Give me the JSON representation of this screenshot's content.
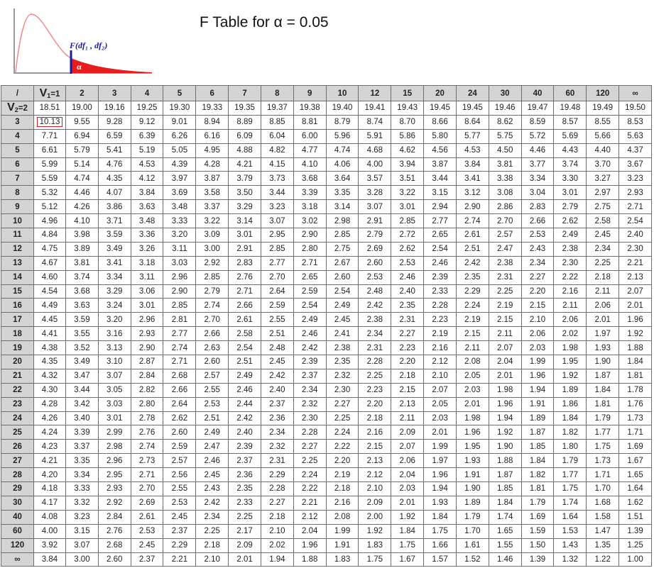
{
  "title": "F Table for α = 0.05",
  "figure": {
    "func_label": "F(df₁ , df₂)",
    "alpha_label": "α",
    "fill_color": "#e81c1c",
    "marker_color": "#1a1aa0"
  },
  "corner": "/",
  "v1_label": {
    "main": "V",
    "sub": "1",
    "suffix": "=1"
  },
  "v2_label": {
    "main": "V",
    "sub": "2",
    "suffix": "=2"
  },
  "col_headers": [
    "2",
    "3",
    "4",
    "5",
    "6",
    "7",
    "8",
    "9",
    "10",
    "12",
    "15",
    "20",
    "24",
    "30",
    "40",
    "60",
    "120",
    "∞"
  ],
  "rows": [
    {
      "df": "2",
      "values": [
        "18.51",
        "19.00",
        "19.16",
        "19.25",
        "19.30",
        "19.33",
        "19.35",
        "19.37",
        "19.38",
        "19.40",
        "19.41",
        "19.43",
        "19.45",
        "19.45",
        "19.46",
        "19.47",
        "19.48",
        "19.49",
        "19.50"
      ]
    },
    {
      "df": "3",
      "values": [
        "10.13",
        "9.55",
        "9.28",
        "9.12",
        "9.01",
        "8.94",
        "8.89",
        "8.85",
        "8.81",
        "8.79",
        "8.74",
        "8.70",
        "8.66",
        "8.64",
        "8.62",
        "8.59",
        "8.57",
        "8.55",
        "8.53"
      ]
    },
    {
      "df": "4",
      "values": [
        "7.71",
        "6.94",
        "6.59",
        "6.39",
        "6.26",
        "6.16",
        "6.09",
        "6.04",
        "6.00",
        "5.96",
        "5.91",
        "5.86",
        "5.80",
        "5.77",
        "5.75",
        "5.72",
        "5.69",
        "5.66",
        "5.63"
      ]
    },
    {
      "df": "5",
      "values": [
        "6.61",
        "5.79",
        "5.41",
        "5.19",
        "5.05",
        "4.95",
        "4.88",
        "4.82",
        "4.77",
        "4.74",
        "4.68",
        "4.62",
        "4.56",
        "4.53",
        "4.50",
        "4.46",
        "4.43",
        "4.40",
        "4.37"
      ]
    },
    {
      "df": "6",
      "values": [
        "5.99",
        "5.14",
        "4.76",
        "4.53",
        "4.39",
        "4.28",
        "4.21",
        "4.15",
        "4.10",
        "4.06",
        "4.00",
        "3.94",
        "3.87",
        "3.84",
        "3.81",
        "3.77",
        "3.74",
        "3.70",
        "3.67"
      ]
    },
    {
      "df": "7",
      "values": [
        "5.59",
        "4.74",
        "4.35",
        "4.12",
        "3.97",
        "3.87",
        "3.79",
        "3.73",
        "3.68",
        "3.64",
        "3.57",
        "3.51",
        "3.44",
        "3.41",
        "3.38",
        "3.34",
        "3.30",
        "3.27",
        "3.23"
      ]
    },
    {
      "df": "8",
      "values": [
        "5.32",
        "4.46",
        "4.07",
        "3.84",
        "3.69",
        "3.58",
        "3.50",
        "3.44",
        "3.39",
        "3.35",
        "3.28",
        "3.22",
        "3.15",
        "3.12",
        "3.08",
        "3.04",
        "3.01",
        "2.97",
        "2.93"
      ]
    },
    {
      "df": "9",
      "values": [
        "5.12",
        "4.26",
        "3.86",
        "3.63",
        "3.48",
        "3.37",
        "3.29",
        "3.23",
        "3.18",
        "3.14",
        "3.07",
        "3.01",
        "2.94",
        "2.90",
        "2.86",
        "2.83",
        "2.79",
        "2.75",
        "2.71"
      ]
    },
    {
      "df": "10",
      "values": [
        "4.96",
        "4.10",
        "3.71",
        "3.48",
        "3.33",
        "3.22",
        "3.14",
        "3.07",
        "3.02",
        "2.98",
        "2.91",
        "2.85",
        "2.77",
        "2.74",
        "2.70",
        "2.66",
        "2.62",
        "2.58",
        "2.54"
      ]
    },
    {
      "df": "11",
      "values": [
        "4.84",
        "3.98",
        "3.59",
        "3.36",
        "3.20",
        "3.09",
        "3.01",
        "2.95",
        "2.90",
        "2.85",
        "2.79",
        "2.72",
        "2.65",
        "2.61",
        "2.57",
        "2.53",
        "2.49",
        "2.45",
        "2.40"
      ]
    },
    {
      "df": "12",
      "values": [
        "4.75",
        "3.89",
        "3.49",
        "3.26",
        "3.11",
        "3.00",
        "2.91",
        "2.85",
        "2.80",
        "2.75",
        "2.69",
        "2.62",
        "2.54",
        "2.51",
        "2.47",
        "2.43",
        "2.38",
        "2.34",
        "2.30"
      ]
    },
    {
      "df": "13",
      "values": [
        "4.67",
        "3.81",
        "3.41",
        "3.18",
        "3.03",
        "2.92",
        "2.83",
        "2.77",
        "2.71",
        "2.67",
        "2.60",
        "2.53",
        "2.46",
        "2.42",
        "2.38",
        "2.34",
        "2.30",
        "2.25",
        "2.21"
      ]
    },
    {
      "df": "14",
      "values": [
        "4.60",
        "3.74",
        "3.34",
        "3.11",
        "2.96",
        "2.85",
        "2.76",
        "2.70",
        "2.65",
        "2.60",
        "2.53",
        "2.46",
        "2.39",
        "2.35",
        "2.31",
        "2.27",
        "2.22",
        "2.18",
        "2.13"
      ]
    },
    {
      "df": "15",
      "values": [
        "4.54",
        "3.68",
        "3.29",
        "3.06",
        "2.90",
        "2.79",
        "2.71",
        "2.64",
        "2.59",
        "2.54",
        "2.48",
        "2.40",
        "2.33",
        "2.29",
        "2.25",
        "2.20",
        "2.16",
        "2.11",
        "2.07"
      ]
    },
    {
      "df": "16",
      "values": [
        "4.49",
        "3.63",
        "3.24",
        "3.01",
        "2.85",
        "2.74",
        "2.66",
        "2.59",
        "2.54",
        "2.49",
        "2.42",
        "2.35",
        "2.28",
        "2.24",
        "2.19",
        "2.15",
        "2.11",
        "2.06",
        "2.01"
      ]
    },
    {
      "df": "17",
      "values": [
        "4.45",
        "3.59",
        "3.20",
        "2.96",
        "2.81",
        "2.70",
        "2.61",
        "2.55",
        "2.49",
        "2.45",
        "2.38",
        "2.31",
        "2.23",
        "2.19",
        "2.15",
        "2.10",
        "2.06",
        "2.01",
        "1.96"
      ]
    },
    {
      "df": "18",
      "values": [
        "4.41",
        "3.55",
        "3.16",
        "2.93",
        "2.77",
        "2.66",
        "2.58",
        "2.51",
        "2.46",
        "2.41",
        "2.34",
        "2.27",
        "2.19",
        "2.15",
        "2.11",
        "2.06",
        "2.02",
        "1.97",
        "1.92"
      ]
    },
    {
      "df": "19",
      "values": [
        "4.38",
        "3.52",
        "3.13",
        "2.90",
        "2.74",
        "2.63",
        "2.54",
        "2.48",
        "2.42",
        "2.38",
        "2.31",
        "2.23",
        "2.16",
        "2.11",
        "2.07",
        "2.03",
        "1.98",
        "1.93",
        "1.88"
      ]
    },
    {
      "df": "20",
      "values": [
        "4.35",
        "3.49",
        "3.10",
        "2.87",
        "2.71",
        "2.60",
        "2.51",
        "2.45",
        "2.39",
        "2.35",
        "2.28",
        "2.20",
        "2.12",
        "2.08",
        "2.04",
        "1.99",
        "1.95",
        "1.90",
        "1.84"
      ]
    },
    {
      "df": "21",
      "values": [
        "4.32",
        "3.47",
        "3.07",
        "2.84",
        "2.68",
        "2.57",
        "2.49",
        "2.42",
        "2.37",
        "2.32",
        "2.25",
        "2.18",
        "2.10",
        "2.05",
        "2.01",
        "1.96",
        "1.92",
        "1.87",
        "1.81"
      ]
    },
    {
      "df": "22",
      "values": [
        "4.30",
        "3.44",
        "3.05",
        "2.82",
        "2.66",
        "2.55",
        "2.46",
        "2.40",
        "2.34",
        "2.30",
        "2.23",
        "2.15",
        "2.07",
        "2.03",
        "1.98",
        "1.94",
        "1.89",
        "1.84",
        "1.78"
      ]
    },
    {
      "df": "23",
      "values": [
        "4.28",
        "3.42",
        "3.03",
        "2.80",
        "2.64",
        "2.53",
        "2.44",
        "2.37",
        "2.32",
        "2.27",
        "2.20",
        "2.13",
        "2.05",
        "2.01",
        "1.96",
        "1.91",
        "1.86",
        "1.81",
        "1.76"
      ]
    },
    {
      "df": "24",
      "values": [
        "4.26",
        "3.40",
        "3.01",
        "2.78",
        "2.62",
        "2.51",
        "2.42",
        "2.36",
        "2.30",
        "2.25",
        "2.18",
        "2.11",
        "2.03",
        "1.98",
        "1.94",
        "1.89",
        "1.84",
        "1.79",
        "1.73"
      ]
    },
    {
      "df": "25",
      "values": [
        "4.24",
        "3.39",
        "2.99",
        "2.76",
        "2.60",
        "2.49",
        "2.40",
        "2.34",
        "2.28",
        "2.24",
        "2.16",
        "2.09",
        "2.01",
        "1.96",
        "1.92",
        "1.87",
        "1.82",
        "1.77",
        "1.71"
      ]
    },
    {
      "df": "26",
      "values": [
        "4.23",
        "3.37",
        "2.98",
        "2.74",
        "2.59",
        "2.47",
        "2.39",
        "2.32",
        "2.27",
        "2.22",
        "2.15",
        "2.07",
        "1.99",
        "1.95",
        "1.90",
        "1.85",
        "1.80",
        "1.75",
        "1.69"
      ]
    },
    {
      "df": "27",
      "values": [
        "4.21",
        "3.35",
        "2.96",
        "2.73",
        "2.57",
        "2.46",
        "2.37",
        "2.31",
        "2.25",
        "2.20",
        "2.13",
        "2.06",
        "1.97",
        "1.93",
        "1.88",
        "1.84",
        "1.79",
        "1.73",
        "1.67"
      ]
    },
    {
      "df": "28",
      "values": [
        "4.20",
        "3.34",
        "2.95",
        "2.71",
        "2.56",
        "2.45",
        "2.36",
        "2.29",
        "2.24",
        "2.19",
        "2.12",
        "2.04",
        "1.96",
        "1.91",
        "1.87",
        "1.82",
        "1.77",
        "1.71",
        "1.65"
      ]
    },
    {
      "df": "29",
      "values": [
        "4.18",
        "3.33",
        "2.93",
        "2.70",
        "2.55",
        "2.43",
        "2.35",
        "2.28",
        "2.22",
        "2.18",
        "2.10",
        "2.03",
        "1.94",
        "1.90",
        "1.85",
        "1.81",
        "1.75",
        "1.70",
        "1.64"
      ]
    },
    {
      "df": "30",
      "values": [
        "4.17",
        "3.32",
        "2.92",
        "2.69",
        "2.53",
        "2.42",
        "2.33",
        "2.27",
        "2.21",
        "2.16",
        "2.09",
        "2.01",
        "1.93",
        "1.89",
        "1.84",
        "1.79",
        "1.74",
        "1.68",
        "1.62"
      ]
    },
    {
      "df": "40",
      "values": [
        "4.08",
        "3.23",
        "2.84",
        "2.61",
        "2.45",
        "2.34",
        "2.25",
        "2.18",
        "2.12",
        "2.08",
        "2.00",
        "1.92",
        "1.84",
        "1.79",
        "1.74",
        "1.69",
        "1.64",
        "1.58",
        "1.51"
      ]
    },
    {
      "df": "60",
      "values": [
        "4.00",
        "3.15",
        "2.76",
        "2.53",
        "2.37",
        "2.25",
        "2.17",
        "2.10",
        "2.04",
        "1.99",
        "1.92",
        "1.84",
        "1.75",
        "1.70",
        "1.65",
        "1.59",
        "1.53",
        "1.47",
        "1.39"
      ]
    },
    {
      "df": "120",
      "values": [
        "3.92",
        "3.07",
        "2.68",
        "2.45",
        "2.29",
        "2.18",
        "2.09",
        "2.02",
        "1.96",
        "1.91",
        "1.83",
        "1.75",
        "1.66",
        "1.61",
        "1.55",
        "1.50",
        "1.43",
        "1.35",
        "1.25"
      ]
    },
    {
      "df": "∞",
      "values": [
        "3.84",
        "3.00",
        "2.60",
        "2.37",
        "2.21",
        "2.10",
        "2.01",
        "1.94",
        "1.88",
        "1.83",
        "1.75",
        "1.67",
        "1.57",
        "1.52",
        "1.46",
        "1.39",
        "1.32",
        "1.22",
        "1.00"
      ]
    }
  ]
}
